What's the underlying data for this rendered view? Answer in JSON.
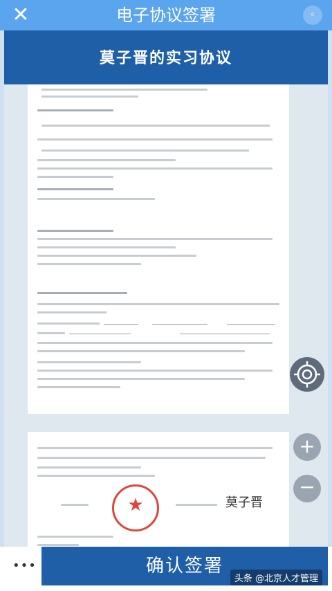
{
  "header": {
    "title": "电子协议签署"
  },
  "document": {
    "title": "莫子晋的实习协议"
  },
  "footer": {
    "confirm_label": "确认签署",
    "more_label": "•••"
  },
  "zoom": {
    "in_label": "+",
    "out_label": "−"
  },
  "watermark": "头条 @北京人才管理",
  "signature": "莫子晋",
  "colors": {
    "header_bg": "#5aa5ee",
    "banner_bg": "#1f5fa8",
    "seal": "#e0453c"
  }
}
